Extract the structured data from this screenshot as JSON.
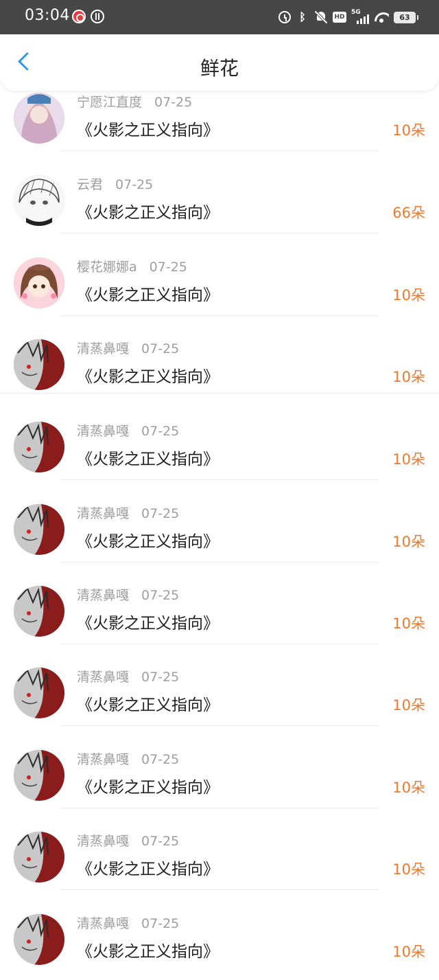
{
  "status_bar": {
    "time": "03:04",
    "signal_label": "5G",
    "battery": "63",
    "icons": [
      "netease-music-icon",
      "app-notification-icon",
      "alarm-icon",
      "bluetooth-icon",
      "mute-icon",
      "hd-icon",
      "signal-icon",
      "wifi-icon",
      "battery-icon"
    ]
  },
  "header": {
    "title": "鲜花",
    "back_icon": "back-arrow-icon",
    "accent_color": "#2e9ae8"
  },
  "colors": {
    "count_color": "#f0792c",
    "meta_color": "#9e9e9e"
  },
  "rows": [
    {
      "name": "宁愿江直度",
      "date": "07-25",
      "book": "《火影之正义指向》",
      "count": "10朵",
      "avatar": "pink-hair-girl"
    },
    {
      "name": "云君",
      "date": "07-25",
      "book": "《火影之正义指向》",
      "count": "66朵",
      "avatar": "sketch-boy"
    },
    {
      "name": "樱花娜娜a",
      "date": "07-25",
      "book": "《火影之正义指向》",
      "count": "10朵",
      "avatar": "cute-girl"
    },
    {
      "name": "清蒸鼻嘎",
      "date": "07-25",
      "book": "《火影之正义指向》",
      "count": "10朵",
      "avatar": "red-white-character"
    },
    {
      "name": "清蒸鼻嘎",
      "date": "07-25",
      "book": "《火影之正义指向》",
      "count": "10朵",
      "avatar": "red-white-character"
    },
    {
      "name": "清蒸鼻嘎",
      "date": "07-25",
      "book": "《火影之正义指向》",
      "count": "10朵",
      "avatar": "red-white-character"
    },
    {
      "name": "清蒸鼻嘎",
      "date": "07-25",
      "book": "《火影之正义指向》",
      "count": "10朵",
      "avatar": "red-white-character"
    },
    {
      "name": "清蒸鼻嘎",
      "date": "07-25",
      "book": "《火影之正义指向》",
      "count": "10朵",
      "avatar": "red-white-character"
    },
    {
      "name": "清蒸鼻嘎",
      "date": "07-25",
      "book": "《火影之正义指向》",
      "count": "10朵",
      "avatar": "red-white-character"
    },
    {
      "name": "清蒸鼻嘎",
      "date": "07-25",
      "book": "《火影之正义指向》",
      "count": "10朵",
      "avatar": "red-white-character"
    },
    {
      "name": "清蒸鼻嘎",
      "date": "07-25",
      "book": "《火影之正义指向》",
      "count": "10朵",
      "avatar": "red-white-character"
    }
  ]
}
